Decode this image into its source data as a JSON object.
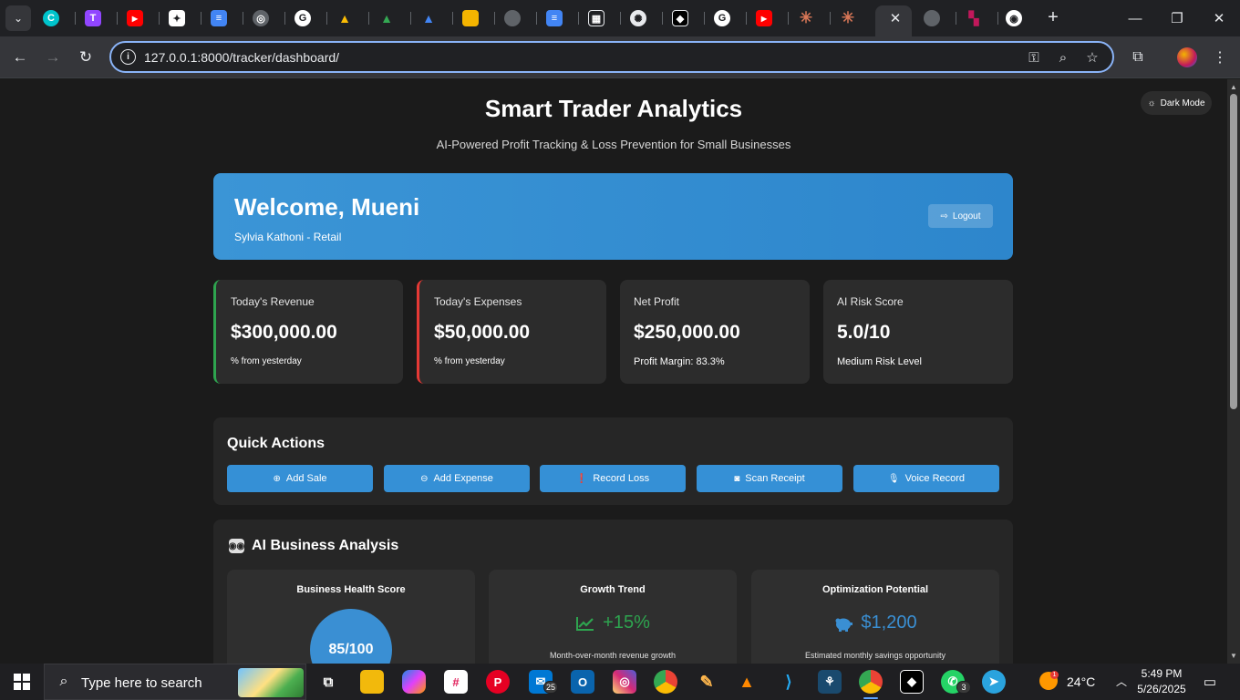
{
  "browser": {
    "url": "127.0.0.1:8000/tracker/dashboard/",
    "tabs": [
      {
        "icon": "canva-icon",
        "glyph": "C",
        "color": "#00c4cc"
      },
      {
        "icon": "twitch-icon",
        "glyph": "T",
        "color": "#9146ff"
      },
      {
        "icon": "youtube-icon",
        "glyph": "▶",
        "color": "#ff0000"
      },
      {
        "icon": "gemini-icon",
        "glyph": "✦",
        "color": "#ffffff"
      },
      {
        "icon": "google-docs-icon",
        "glyph": "≡",
        "color": "#4285f4"
      },
      {
        "icon": "chrome-icon",
        "glyph": "◎",
        "color": "#9aa0a6"
      },
      {
        "icon": "google-icon",
        "glyph": "G",
        "color": "#ffffff"
      },
      {
        "icon": "google-drive-icon",
        "glyph": "▲",
        "color": "#fbbc04"
      },
      {
        "icon": "google-drive-icon",
        "glyph": "▲",
        "color": "#34a853"
      },
      {
        "icon": "google-drive-icon",
        "glyph": "▲",
        "color": "#4285f4"
      },
      {
        "icon": "google-slides-icon",
        "glyph": "▭",
        "color": "#f4b400"
      },
      {
        "icon": "globe-icon",
        "glyph": "◍",
        "color": "#5f6368"
      },
      {
        "icon": "google-docs-icon",
        "glyph": "≡",
        "color": "#4285f4"
      },
      {
        "icon": "qr-icon",
        "glyph": "▦",
        "color": "#e8eaed"
      },
      {
        "icon": "openai-icon",
        "glyph": "✺",
        "color": "#e8eaed"
      },
      {
        "icon": "box-icon",
        "glyph": "◆",
        "color": "#ffffff"
      },
      {
        "icon": "google-icon",
        "glyph": "G",
        "color": "#ffffff"
      },
      {
        "icon": "youtube-icon",
        "glyph": "▶",
        "color": "#ff0000"
      },
      {
        "icon": "claude-icon",
        "glyph": "✳",
        "color": "#d97757"
      },
      {
        "icon": "claude-icon",
        "glyph": "✳",
        "color": "#d97757"
      },
      {
        "icon": "globe-icon",
        "glyph": "◍",
        "color": "#5f6368"
      },
      {
        "icon": "app-icon",
        "glyph": "▚",
        "color": "#c2185b"
      },
      {
        "icon": "github-icon",
        "glyph": "◉",
        "color": "#ffffff"
      }
    ]
  },
  "theme_toggle": {
    "icon": "sun-icon",
    "label": "Dark Mode"
  },
  "header": {
    "title": "Smart Trader Analytics",
    "subtitle": "AI-Powered Profit Tracking & Loss Prevention for Small Businesses"
  },
  "welcome": {
    "title": "Welcome, Mueni",
    "subtitle": "Sylvia Kathoni - Retail",
    "logout_label": "Logout"
  },
  "stats": [
    {
      "label": "Today's Revenue",
      "value": "$300,000.00",
      "note": "% from yesterday",
      "accent": "#2ea44f"
    },
    {
      "label": "Today's Expenses",
      "value": "$50,000.00",
      "note": "% from yesterday",
      "accent": "#e53935"
    },
    {
      "label": "Net Profit",
      "value": "$250,000.00",
      "note": "Profit Margin: 83.3%"
    },
    {
      "label": "AI Risk Score",
      "value": "5.0/10",
      "note": "Medium Risk Level"
    }
  ],
  "quick_actions": {
    "title": "Quick Actions",
    "buttons": [
      {
        "label": "Add Sale",
        "icon": "plus-circle-icon"
      },
      {
        "label": "Add Expense",
        "icon": "minus-circle-icon"
      },
      {
        "label": "Record Loss",
        "icon": "exclamation-circle-icon"
      },
      {
        "label": "Scan Receipt",
        "icon": "camera-icon"
      },
      {
        "label": "Voice Record",
        "icon": "microphone-icon"
      }
    ]
  },
  "ai_analysis": {
    "title": "AI Business Analysis",
    "icon": "robot-icon",
    "cards": [
      {
        "title": "Business Health Score",
        "value": "85/100"
      },
      {
        "title": "Growth Trend",
        "value": "+15%",
        "icon": "chart-line-icon",
        "description": "Month-over-month revenue growth"
      },
      {
        "title": "Optimization Potential",
        "value": "$1,200",
        "icon": "piggy-bank-icon",
        "description": "Estimated monthly savings opportunity"
      }
    ]
  },
  "taskbar": {
    "search_placeholder": "Type here to search",
    "apps": [
      {
        "icon": "task-view-icon"
      },
      {
        "icon": "file-explorer-icon"
      },
      {
        "icon": "copilot-icon"
      },
      {
        "icon": "slack-icon"
      },
      {
        "icon": "pinterest-icon"
      },
      {
        "icon": "mail-icon",
        "badge": "25"
      },
      {
        "icon": "outlook-icon"
      },
      {
        "icon": "instagram-icon"
      },
      {
        "icon": "chrome-icon"
      },
      {
        "icon": "paint-icon"
      },
      {
        "icon": "vlc-icon"
      },
      {
        "icon": "vscode-icon"
      },
      {
        "icon": "mysql-workbench-icon"
      },
      {
        "icon": "chrome-profile-icon"
      },
      {
        "icon": "capcut-icon"
      },
      {
        "icon": "whatsapp-icon",
        "badge": "3"
      },
      {
        "icon": "telegram-icon"
      }
    ],
    "weather_badge": "1",
    "temperature": "24°C",
    "time": "5:49 PM",
    "date": "5/26/2025"
  }
}
